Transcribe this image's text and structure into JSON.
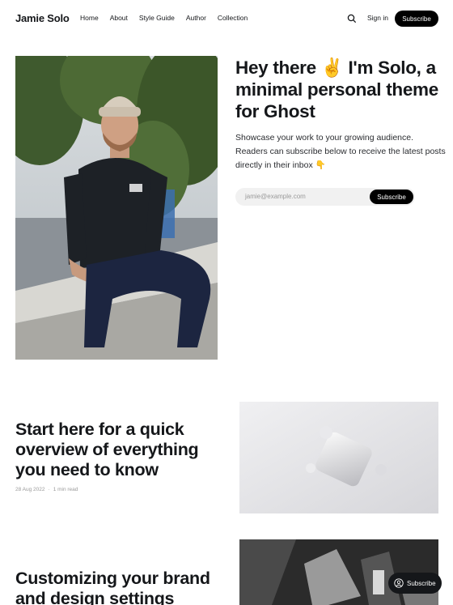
{
  "header": {
    "brand": "Jamie Solo",
    "nav": [
      {
        "label": "Home"
      },
      {
        "label": "About"
      },
      {
        "label": "Style Guide"
      },
      {
        "label": "Author"
      },
      {
        "label": "Collection"
      }
    ],
    "search_icon": "search-icon",
    "signin_label": "Sign in",
    "subscribe_label": "Subscribe"
  },
  "hero": {
    "title": "Hey there ✌️ I'm Solo, a minimal personal theme for Ghost",
    "description": "Showcase your work to your growing audience. Readers can subscribe below to receive the latest posts directly in their inbox 👇",
    "email_placeholder": "jamie@example.com",
    "subscribe_label": "Subscribe"
  },
  "posts": [
    {
      "title": "Start here for a quick overview of everything you need to know",
      "date": "28 Aug 2022",
      "reading_time": "1 min read"
    },
    {
      "title": "Customizing your brand and design settings"
    }
  ],
  "portal": {
    "label": "Subscribe",
    "icon": "user-circle-icon"
  },
  "colors": {
    "accent": "#000000",
    "text": "#15171a",
    "muted": "#9a9a9a"
  }
}
